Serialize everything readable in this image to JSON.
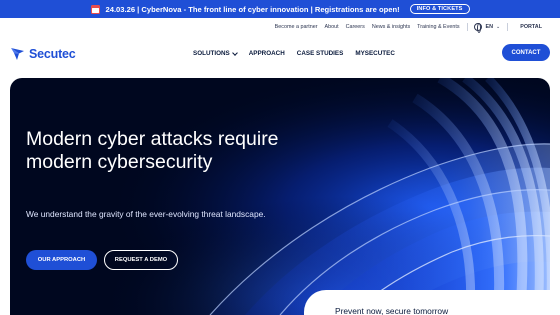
{
  "announcement": {
    "text": "24.03.26 | CyberNova - The front line of cyber innovation | Registrations are open!",
    "button_label": "INFO & TICKETS",
    "icon": "calendar-icon"
  },
  "utility_nav": {
    "links": [
      "Become a partner",
      "About",
      "Careers",
      "News & insights",
      "Training & Events"
    ],
    "language": "EN",
    "portal": "PORTAL"
  },
  "header": {
    "brand": "Secutec",
    "menu": [
      {
        "label": "SOLUTIONS",
        "has_dropdown": true
      },
      {
        "label": "APPROACH",
        "has_dropdown": false
      },
      {
        "label": "CASE STUDIES",
        "has_dropdown": false
      },
      {
        "label": "MYSECUTEC",
        "has_dropdown": false
      }
    ],
    "contact_label": "CONTACT"
  },
  "hero": {
    "title": "Modern cyber attacks require modern cybersecurity",
    "subtitle": "We understand the gravity of the ever-evolving threat landscape.",
    "primary_cta": "OUR APPROACH",
    "secondary_cta": "REQUEST A DEMO",
    "tagline": "Prevent now, secure tomorrow"
  },
  "colors": {
    "brand_blue": "#1f4fd6",
    "hero_dark": "#00071f",
    "text_dark": "#0a1a3c"
  }
}
